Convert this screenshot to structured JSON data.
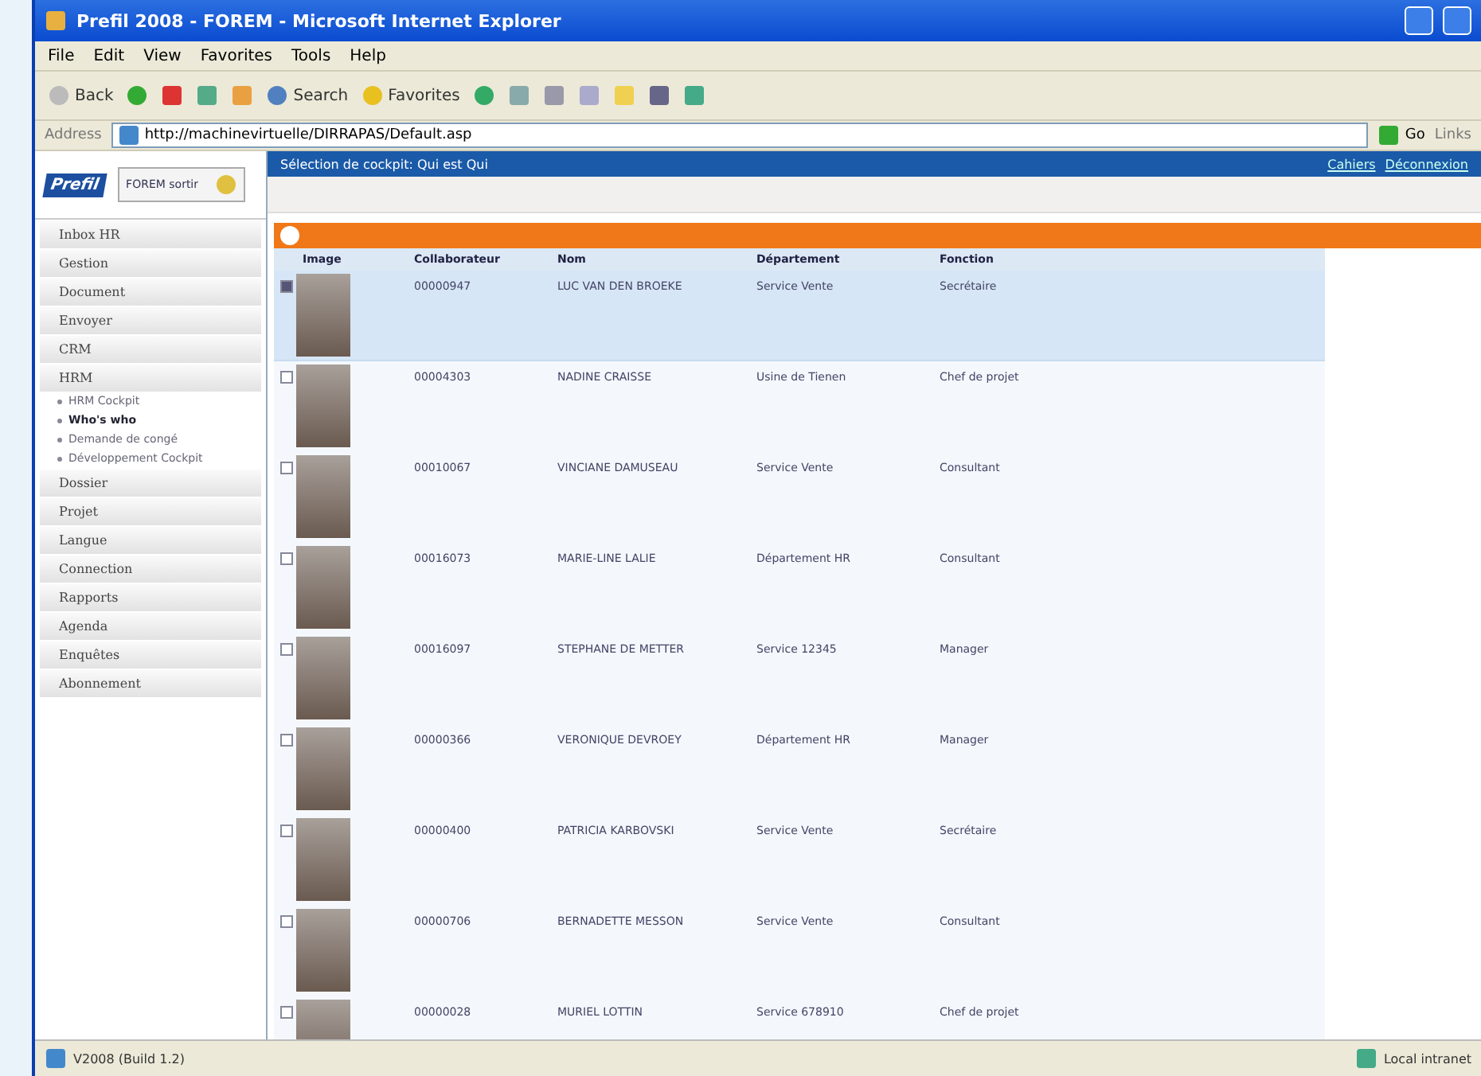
{
  "window": {
    "title": "Prefil 2008 - FOREM - Microsoft Internet Explorer"
  },
  "menu": [
    "File",
    "Edit",
    "View",
    "Favorites",
    "Tools",
    "Help"
  ],
  "toolbar": {
    "back": "Back",
    "search": "Search",
    "favorites": "Favorites"
  },
  "address": {
    "label": "Address",
    "url": "http://machinevirtuelle/DIRRAPAS/Default.asp",
    "go": "Go",
    "links": "Links"
  },
  "app": {
    "logo": "Prefil",
    "org_button": "FOREM sortir",
    "header_title": "Sélection de cockpit: Qui est Qui",
    "header_links": [
      "Cahiers",
      "Déconnexion"
    ]
  },
  "sidebar": {
    "items": [
      {
        "label": "Inbox HR"
      },
      {
        "label": "Gestion"
      },
      {
        "label": "Document"
      },
      {
        "label": "Envoyer"
      },
      {
        "label": "CRM"
      },
      {
        "label": "HRM",
        "children": [
          {
            "label": "HRM Cockpit",
            "selected": false
          },
          {
            "label": "Who's who",
            "selected": true
          },
          {
            "label": "Demande de congé",
            "selected": false
          },
          {
            "label": "Développement Cockpit",
            "selected": false
          }
        ]
      },
      {
        "label": "Dossier"
      },
      {
        "label": "Projet"
      },
      {
        "label": "Langue"
      },
      {
        "label": "Connection"
      },
      {
        "label": "Rapports"
      },
      {
        "label": "Agenda"
      },
      {
        "label": "Enquêtes"
      },
      {
        "label": "Abonnement"
      }
    ]
  },
  "table": {
    "columns": [
      "Image",
      "Collaborateur",
      "Nom",
      "Département",
      "Fonction"
    ],
    "rows": [
      {
        "id": "00000947",
        "name": "LUC VAN DEN BROEKE",
        "department": "Service Vente",
        "function": "Secrétaire",
        "checked": true,
        "selected": true
      },
      {
        "id": "00004303",
        "name": "NADINE CRAISSE",
        "department": "Usine de Tienen",
        "function": "Chef de projet",
        "checked": false,
        "selected": false
      },
      {
        "id": "00010067",
        "name": "VINCIANE DAMUSEAU",
        "department": "Service Vente",
        "function": "Consultant",
        "checked": false,
        "selected": false
      },
      {
        "id": "00016073",
        "name": "MARIE-LINE LALIE",
        "department": "Département HR",
        "function": "Consultant",
        "checked": false,
        "selected": false
      },
      {
        "id": "00016097",
        "name": "STEPHANE DE METTER",
        "department": "Service 12345",
        "function": "Manager",
        "checked": false,
        "selected": false
      },
      {
        "id": "00000366",
        "name": "VERONIQUE DEVROEY",
        "department": "Département HR",
        "function": "Manager",
        "checked": false,
        "selected": false
      },
      {
        "id": "00000400",
        "name": "PATRICIA KARBOVSKI",
        "department": "Service Vente",
        "function": "Secrétaire",
        "checked": false,
        "selected": false
      },
      {
        "id": "00000706",
        "name": "BERNADETTE MESSON",
        "department": "Service Vente",
        "function": "Consultant",
        "checked": false,
        "selected": false
      },
      {
        "id": "00000028",
        "name": "MURIEL LOTTIN",
        "department": "Service 678910",
        "function": "Chef de projet",
        "checked": false,
        "selected": false
      }
    ]
  },
  "status_bar": {
    "left": "V2008 (Build 1.2)",
    "right": "Local intranet"
  }
}
